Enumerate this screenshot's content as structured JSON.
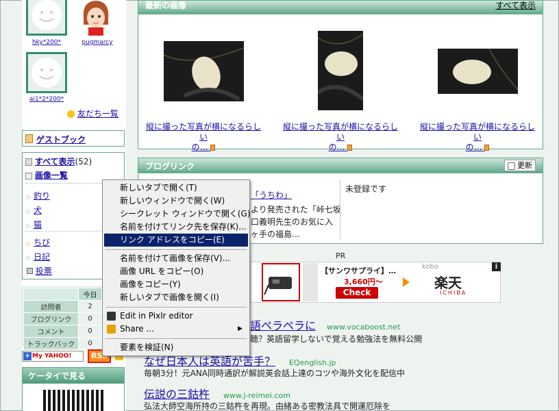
{
  "sidebar": {
    "friends": [
      {
        "name": "hky*200*"
      },
      {
        "name": "pugmarcy"
      },
      {
        "name": "ai1*2*200*"
      }
    ],
    "friends_all_link": "友だち一覧",
    "guestbook": "ゲストブック",
    "show_all": "すべて表示",
    "show_all_count": "(52)",
    "image_list": "画像一覧",
    "categories": [
      "釣り",
      "犬",
      "猫",
      "ちび",
      "日記",
      "投票"
    ],
    "stats": {
      "today_header": "今日",
      "rows": [
        {
          "label": "訪問者",
          "value": "2"
        },
        {
          "label": "ブログリンク",
          "value": "0"
        },
        {
          "label": "コメント",
          "value": "0"
        },
        {
          "label": "トラックバック",
          "value": "0"
        }
      ]
    },
    "my_yahoo": "My YAHOO!",
    "rss": "RSS",
    "mobile_head": "ケータイで見る"
  },
  "latest_images": {
    "title": "最新の画像",
    "show_all": "すべて表示",
    "items": [
      {
        "caption_line1": "縦に撮った写真が横になるらしい",
        "caption_line2": "の…"
      },
      {
        "caption_line1": "縦に撮った写真が横になるらしい",
        "caption_line2": "の…"
      },
      {
        "caption_line1": "縦に撮った写真が横になるらしい",
        "caption_line2": "の…"
      }
    ]
  },
  "blog_link": {
    "title": "ブログリンク",
    "refresh": "更新",
    "left_link": "「うちわ」",
    "left_text": [
      "より発売された「峠七坂",
      "口義明先生のお気に入",
      "ヶ手の福島…"
    ],
    "right_text": "未登録です"
  },
  "pr": {
    "label": "PR",
    "banner_title": "【サンワサプライ】…",
    "banner_price": "3,660円〜",
    "banner_check": "Check",
    "rakuten": "楽天",
    "rakuten_small": "ICHIBA",
    "kobo": "kobo",
    "info": "i"
  },
  "ads": [
    {
      "title": "語ペラペラに",
      "url": "www.vocaboost.net",
      "desc": "聴？英語留学しないで覚える勉強法を無料公開"
    },
    {
      "title": "なぜ日本人は英語が苦手？",
      "url": "EQenglish.jp",
      "desc": "毎朝3分！元ANA同時通訳が解説英会話上達のコツや海外文化を配信中"
    },
    {
      "title": "伝説の三鈷杵",
      "url": "www.j-reimei.com",
      "desc": "弘法大師空海所持の三鈷杵を再現。由緒ある密教法具で開運厄除を"
    }
  ],
  "context_menu": {
    "items": [
      {
        "label": "新しいタブで開く(T)"
      },
      {
        "label": "新しいウィンドウで開く(W)"
      },
      {
        "label": "シークレット ウィンドウで開く(G)"
      },
      {
        "label": "名前を付けてリンク先を保存(K)..."
      },
      {
        "label": "リンク アドレスをコピー(E)"
      },
      {
        "label": "名前を付けて画像を保存(V)..."
      },
      {
        "label": "画像 URL をコピー(O)"
      },
      {
        "label": "画像をコピー(Y)"
      },
      {
        "label": "新しいタブで画像を開く(I)"
      },
      {
        "label": "Edit in Pixlr editor"
      },
      {
        "label": "Share ..."
      },
      {
        "label": "要素を検証(N)"
      }
    ]
  }
}
